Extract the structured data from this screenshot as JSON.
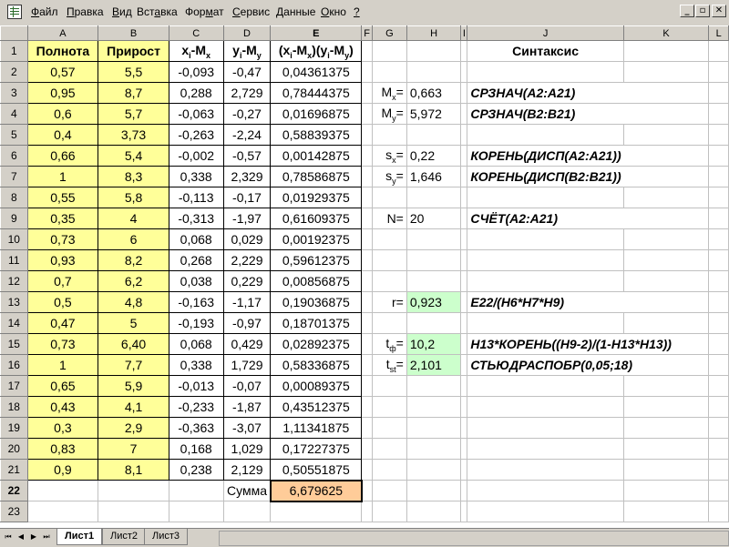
{
  "menu": {
    "items": [
      {
        "pre": "",
        "u": "Ф",
        "post": "айл"
      },
      {
        "pre": "",
        "u": "П",
        "post": "равка"
      },
      {
        "pre": "",
        "u": "В",
        "post": "ид"
      },
      {
        "pre": "Вст",
        "u": "а",
        "post": "вка"
      },
      {
        "pre": "Фор",
        "u": "м",
        "post": "ат"
      },
      {
        "pre": "",
        "u": "С",
        "post": "ервис"
      },
      {
        "pre": "",
        "u": "Д",
        "post": "анные"
      },
      {
        "pre": "",
        "u": "О",
        "post": "кно"
      },
      {
        "pre": "",
        "u": "?",
        "post": ""
      }
    ],
    "window_buttons": [
      "_",
      "▫",
      "✕"
    ]
  },
  "columns": [
    "A",
    "B",
    "C",
    "D",
    "E",
    "F",
    "G",
    "H",
    "I",
    "J",
    "K",
    "L"
  ],
  "header_row": {
    "a": "Полнота",
    "b": "Прирост",
    "c_main": "x",
    "c_sub1": "i",
    "c_mid": "-M",
    "c_sub2": "x",
    "d_main": "y",
    "d_sub1": "i",
    "d_mid": "-M",
    "d_sub2": "y",
    "e_p1": "(x",
    "e_s1": "i",
    "e_p2": "-M",
    "e_s2": "x",
    "e_p3": ")(y",
    "e_s3": "i",
    "e_p4": "-M",
    "e_s4": "y",
    "e_p5": ")",
    "j": "Синтаксис"
  },
  "rows": [
    {
      "n": "2",
      "a": "0,57",
      "b": "5,5",
      "c": "-0,093",
      "d": "-0,47",
      "e": "0,04361375"
    },
    {
      "n": "3",
      "a": "0,95",
      "b": "8,7",
      "c": "0,288",
      "d": "2,729",
      "e": "0,78444375"
    },
    {
      "n": "4",
      "a": "0,6",
      "b": "5,7",
      "c": "-0,063",
      "d": "-0,27",
      "e": "0,01696875"
    },
    {
      "n": "5",
      "a": "0,4",
      "b": "3,73",
      "c": "-0,263",
      "d": "-2,24",
      "e": "0,58839375"
    },
    {
      "n": "6",
      "a": "0,66",
      "b": "5,4",
      "c": "-0,002",
      "d": "-0,57",
      "e": "0,00142875"
    },
    {
      "n": "7",
      "a": "1",
      "b": "8,3",
      "c": "0,338",
      "d": "2,329",
      "e": "0,78586875"
    },
    {
      "n": "8",
      "a": "0,55",
      "b": "5,8",
      "c": "-0,113",
      "d": "-0,17",
      "e": "0,01929375"
    },
    {
      "n": "9",
      "a": "0,35",
      "b": "4",
      "c": "-0,313",
      "d": "-1,97",
      "e": "0,61609375"
    },
    {
      "n": "10",
      "a": "0,73",
      "b": "6",
      "c": "0,068",
      "d": "0,029",
      "e": "0,00192375"
    },
    {
      "n": "11",
      "a": "0,93",
      "b": "8,2",
      "c": "0,268",
      "d": "2,229",
      "e": "0,59612375"
    },
    {
      "n": "12",
      "a": "0,7",
      "b": "6,2",
      "c": "0,038",
      "d": "0,229",
      "e": "0,00856875"
    },
    {
      "n": "13",
      "a": "0,5",
      "b": "4,8",
      "c": "-0,163",
      "d": "-1,17",
      "e": "0,19036875"
    },
    {
      "n": "14",
      "a": "0,47",
      "b": "5",
      "c": "-0,193",
      "d": "-0,97",
      "e": "0,18701375"
    },
    {
      "n": "15",
      "a": "0,73",
      "b": "6,40",
      "c": "0,068",
      "d": "0,429",
      "e": "0,02892375"
    },
    {
      "n": "16",
      "a": "1",
      "b": "7,7",
      "c": "0,338",
      "d": "1,729",
      "e": "0,58336875"
    },
    {
      "n": "17",
      "a": "0,65",
      "b": "5,9",
      "c": "-0,013",
      "d": "-0,07",
      "e": "0,00089375"
    },
    {
      "n": "18",
      "a": "0,43",
      "b": "4,1",
      "c": "-0,233",
      "d": "-1,87",
      "e": "0,43512375"
    },
    {
      "n": "19",
      "a": "0,3",
      "b": "2,9",
      "c": "-0,363",
      "d": "-3,07",
      "e": "1,11341875"
    },
    {
      "n": "20",
      "a": "0,83",
      "b": "7",
      "c": "0,168",
      "d": "1,029",
      "e": "0,17227375"
    },
    {
      "n": "21",
      "a": "0,9",
      "b": "8,1",
      "c": "0,238",
      "d": "2,129",
      "e": "0,50551875"
    }
  ],
  "sum_row": {
    "n": "22",
    "label": "Сумма",
    "value": "6,679625"
  },
  "last_row": {
    "n": "23"
  },
  "stats": {
    "mx": {
      "row": "3",
      "lbl_main": "M",
      "lbl_sub": "x",
      "lbl_eq": "=",
      "value": "0,663",
      "syntax": "СРЗНАЧ(A2:A21)"
    },
    "my": {
      "row": "4",
      "lbl_main": "M",
      "lbl_sub": "y",
      "lbl_eq": "=",
      "value": "5,972",
      "syntax": "СРЗНАЧ(B2:B21)"
    },
    "sx": {
      "row": "6",
      "lbl_main": "s",
      "lbl_sub": "x",
      "lbl_eq": "=",
      "value": "0,22",
      "syntax": "КОРЕНЬ(ДИСП(A2:A21))"
    },
    "sy": {
      "row": "7",
      "lbl_main": "s",
      "lbl_sub": "y",
      "lbl_eq": "=",
      "value": "1,646",
      "syntax": "КОРЕНЬ(ДИСП(B2:B21))"
    },
    "n": {
      "row": "9",
      "label": "N=",
      "value": "20",
      "syntax": "СЧЁТ(A2:A21)"
    },
    "r": {
      "row": "13",
      "label": "r=",
      "value": "0,923",
      "syntax": "E22/(H6*H7*H9)"
    },
    "tf": {
      "row": "15",
      "lbl_main": "t",
      "lbl_sub": "ф",
      "lbl_eq": "=",
      "value": "10,2",
      "syntax": "H13*КОРЕНЬ((H9-2)/(1-H13*H13))"
    },
    "tst": {
      "row": "16",
      "lbl_main": "t",
      "lbl_sub": "st",
      "lbl_eq": "=",
      "value": "2,101",
      "syntax": "СТЬЮДРАСПОБР(0,05;18)"
    }
  },
  "tabs": [
    "Лист1",
    "Лист2",
    "Лист3"
  ],
  "active_tab": "Лист1"
}
